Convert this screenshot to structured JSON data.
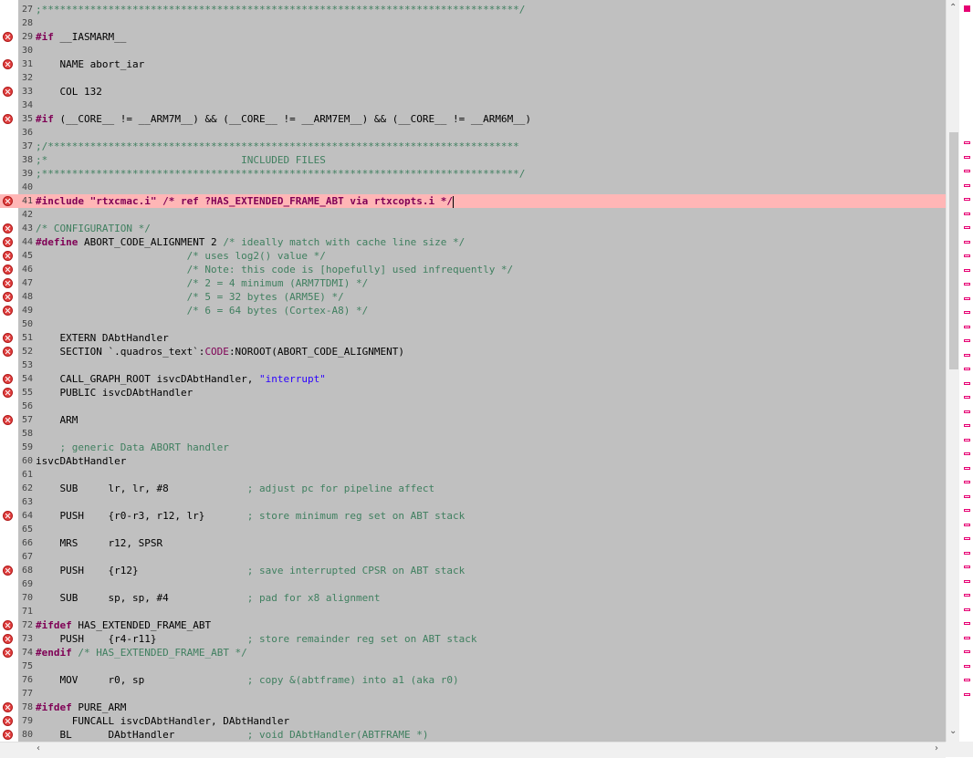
{
  "editor": {
    "lines": [
      {
        "n": "27",
        "err": false,
        "tokens": [
          {
            "t": ";*******************************************************************************/",
            "c": "cm"
          }
        ]
      },
      {
        "n": "28",
        "err": false,
        "tokens": []
      },
      {
        "n": "29",
        "err": true,
        "tokens": [
          {
            "t": "#if",
            "c": "pp"
          },
          {
            "t": " __IASMARM__",
            "c": ""
          }
        ]
      },
      {
        "n": "30",
        "err": false,
        "tokens": []
      },
      {
        "n": "31",
        "err": true,
        "tokens": [
          {
            "t": "    NAME abort_iar",
            "c": ""
          }
        ]
      },
      {
        "n": "32",
        "err": false,
        "tokens": []
      },
      {
        "n": "33",
        "err": true,
        "tokens": [
          {
            "t": "    COL 132",
            "c": ""
          }
        ]
      },
      {
        "n": "34",
        "err": false,
        "tokens": []
      },
      {
        "n": "35",
        "err": true,
        "tokens": [
          {
            "t": "#if",
            "c": "pp"
          },
          {
            "t": " (__CORE__ != __ARM7M__) && (__CORE__ != __ARM7EM__) && (__CORE__ != __ARM6M__)",
            "c": ""
          }
        ]
      },
      {
        "n": "36",
        "err": false,
        "tokens": []
      },
      {
        "n": "37",
        "err": false,
        "tokens": [
          {
            "t": ";/******************************************************************************",
            "c": "cm"
          }
        ]
      },
      {
        "n": "38",
        "err": false,
        "tokens": [
          {
            "t": ";*                                INCLUDED FILES",
            "c": "cm"
          }
        ]
      },
      {
        "n": "39",
        "err": false,
        "tokens": [
          {
            "t": ";*******************************************************************************/",
            "c": "cm"
          }
        ]
      },
      {
        "n": "40",
        "err": false,
        "tokens": []
      },
      {
        "n": "41",
        "err": true,
        "hl": true,
        "cursor": true,
        "tokens": [
          {
            "t": "#include \"rtxcmac.i\" /* ref ?HAS_EXTENDED_FRAME_ABT via rtxcopts.i */",
            "c": "pp"
          }
        ]
      },
      {
        "n": "42",
        "err": false,
        "tokens": []
      },
      {
        "n": "43",
        "err": true,
        "tokens": [
          {
            "t": "/* CONFIGURATION */",
            "c": "cm"
          }
        ]
      },
      {
        "n": "44",
        "err": true,
        "tokens": [
          {
            "t": "#define",
            "c": "pp"
          },
          {
            "t": " ABORT_CODE_ALIGNMENT 2 ",
            "c": ""
          },
          {
            "t": "/* ideally match with cache line size */",
            "c": "cm"
          }
        ]
      },
      {
        "n": "45",
        "err": true,
        "tokens": [
          {
            "t": "                         /* uses log2() value */",
            "c": "cm"
          }
        ]
      },
      {
        "n": "46",
        "err": true,
        "tokens": [
          {
            "t": "                         /* Note: this code is [hopefully] used infrequently */",
            "c": "cm"
          }
        ]
      },
      {
        "n": "47",
        "err": true,
        "tokens": [
          {
            "t": "                         /* 2 = 4 minimum (ARM7TDMI) */",
            "c": "cm"
          }
        ]
      },
      {
        "n": "48",
        "err": true,
        "tokens": [
          {
            "t": "                         /* 5 = 32 bytes (ARM5E) */",
            "c": "cm"
          }
        ]
      },
      {
        "n": "49",
        "err": true,
        "tokens": [
          {
            "t": "                         /* 6 = 64 bytes (Cortex-A8) */",
            "c": "cm"
          }
        ]
      },
      {
        "n": "50",
        "err": false,
        "tokens": []
      },
      {
        "n": "51",
        "err": true,
        "tokens": [
          {
            "t": "    EXTERN DAbtHandler",
            "c": ""
          }
        ]
      },
      {
        "n": "52",
        "err": true,
        "tokens": [
          {
            "t": "    SECTION `.quadros_text`:",
            "c": ""
          },
          {
            "t": "CODE",
            "c": "kw"
          },
          {
            "t": ":NOROOT(ABORT_CODE_ALIGNMENT)",
            "c": ""
          }
        ]
      },
      {
        "n": "53",
        "err": false,
        "tokens": []
      },
      {
        "n": "54",
        "err": true,
        "tokens": [
          {
            "t": "    CALL_GRAPH_ROOT isvcDAbtHandler, ",
            "c": ""
          },
          {
            "t": "\"interrupt\"",
            "c": "st"
          }
        ]
      },
      {
        "n": "55",
        "err": true,
        "tokens": [
          {
            "t": "    PUBLIC isvcDAbtHandler",
            "c": ""
          }
        ]
      },
      {
        "n": "56",
        "err": false,
        "tokens": []
      },
      {
        "n": "57",
        "err": true,
        "tokens": [
          {
            "t": "    ARM",
            "c": ""
          }
        ]
      },
      {
        "n": "58",
        "err": false,
        "tokens": []
      },
      {
        "n": "59",
        "err": false,
        "tokens": [
          {
            "t": "    ; generic Data ABORT handler",
            "c": "cm"
          }
        ]
      },
      {
        "n": "60",
        "err": false,
        "tokens": [
          {
            "t": "isvcDAbtHandler",
            "c": ""
          }
        ]
      },
      {
        "n": "61",
        "err": false,
        "tokens": []
      },
      {
        "n": "62",
        "err": false,
        "tokens": [
          {
            "t": "    SUB     lr, lr, #8             ",
            "c": ""
          },
          {
            "t": "; adjust pc for pipeline affect",
            "c": "cm"
          }
        ]
      },
      {
        "n": "63",
        "err": false,
        "tokens": []
      },
      {
        "n": "64",
        "err": true,
        "tokens": [
          {
            "t": "    PUSH    {r0-r3, r12, lr}       ",
            "c": ""
          },
          {
            "t": "; store minimum reg set on ABT stack",
            "c": "cm"
          }
        ]
      },
      {
        "n": "65",
        "err": false,
        "tokens": []
      },
      {
        "n": "66",
        "err": false,
        "tokens": [
          {
            "t": "    MRS     r12, SPSR",
            "c": ""
          }
        ]
      },
      {
        "n": "67",
        "err": false,
        "tokens": []
      },
      {
        "n": "68",
        "err": true,
        "tokens": [
          {
            "t": "    PUSH    {r12}                  ",
            "c": ""
          },
          {
            "t": "; save interrupted CPSR on ABT stack",
            "c": "cm"
          }
        ]
      },
      {
        "n": "69",
        "err": false,
        "tokens": []
      },
      {
        "n": "70",
        "err": false,
        "tokens": [
          {
            "t": "    SUB     sp, sp, #4             ",
            "c": ""
          },
          {
            "t": "; pad for x8 alignment",
            "c": "cm"
          }
        ]
      },
      {
        "n": "71",
        "err": false,
        "tokens": []
      },
      {
        "n": "72",
        "err": true,
        "tokens": [
          {
            "t": "#ifdef",
            "c": "pp"
          },
          {
            "t": " HAS_EXTENDED_FRAME_ABT",
            "c": ""
          }
        ]
      },
      {
        "n": "73",
        "err": true,
        "tokens": [
          {
            "t": "    PUSH    {r4-r11}               ",
            "c": ""
          },
          {
            "t": "; store remainder reg set on ABT stack",
            "c": "cm"
          }
        ]
      },
      {
        "n": "74",
        "err": true,
        "tokens": [
          {
            "t": "#endif",
            "c": "pp"
          },
          {
            "t": " /* HAS_EXTENDED_FRAME_ABT */",
            "c": "cm"
          }
        ]
      },
      {
        "n": "75",
        "err": false,
        "tokens": []
      },
      {
        "n": "76",
        "err": false,
        "tokens": [
          {
            "t": "    MOV     r0, sp                 ",
            "c": ""
          },
          {
            "t": "; copy &(abtframe) into a1 (aka r0)",
            "c": "cm"
          }
        ]
      },
      {
        "n": "77",
        "err": false,
        "tokens": []
      },
      {
        "n": "78",
        "err": true,
        "tokens": [
          {
            "t": "#ifdef",
            "c": "pp"
          },
          {
            "t": " PURE_ARM",
            "c": ""
          }
        ]
      },
      {
        "n": "79",
        "err": true,
        "tokens": [
          {
            "t": "      FUNCALL isvcDAbtHandler, DAbtHandler",
            "c": ""
          }
        ]
      },
      {
        "n": "80",
        "err": true,
        "tokens": [
          {
            "t": "    BL      DAbtHandler            ",
            "c": ""
          },
          {
            "t": "; void DAbtHandler(ABTFRAME *)",
            "c": "cm"
          }
        ]
      }
    ]
  },
  "overview": {
    "marker_count": 40
  },
  "scrollbars": {
    "up_icon": "chevron-up",
    "down_icon": "chevron-down",
    "left_icon": "chevron-left",
    "right_icon": "chevron-right"
  }
}
